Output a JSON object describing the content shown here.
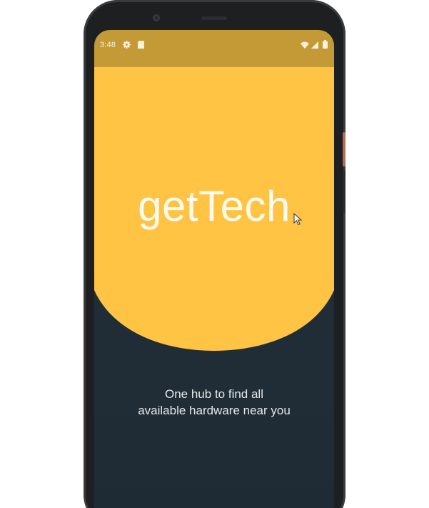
{
  "status_bar": {
    "time": "3:48",
    "icons": [
      "gear-icon",
      "sd-card-icon",
      "wifi-icon",
      "signal-icon",
      "battery-icon"
    ]
  },
  "splash": {
    "app_name": "getTech",
    "tagline_line1": "One hub to find all",
    "tagline_line2": "available hardware near you"
  },
  "colors": {
    "status_bar": "#c49a36",
    "hero_yellow": "#ffc444",
    "background_dark": "#22303a",
    "text_light": "#fdfaf0"
  }
}
